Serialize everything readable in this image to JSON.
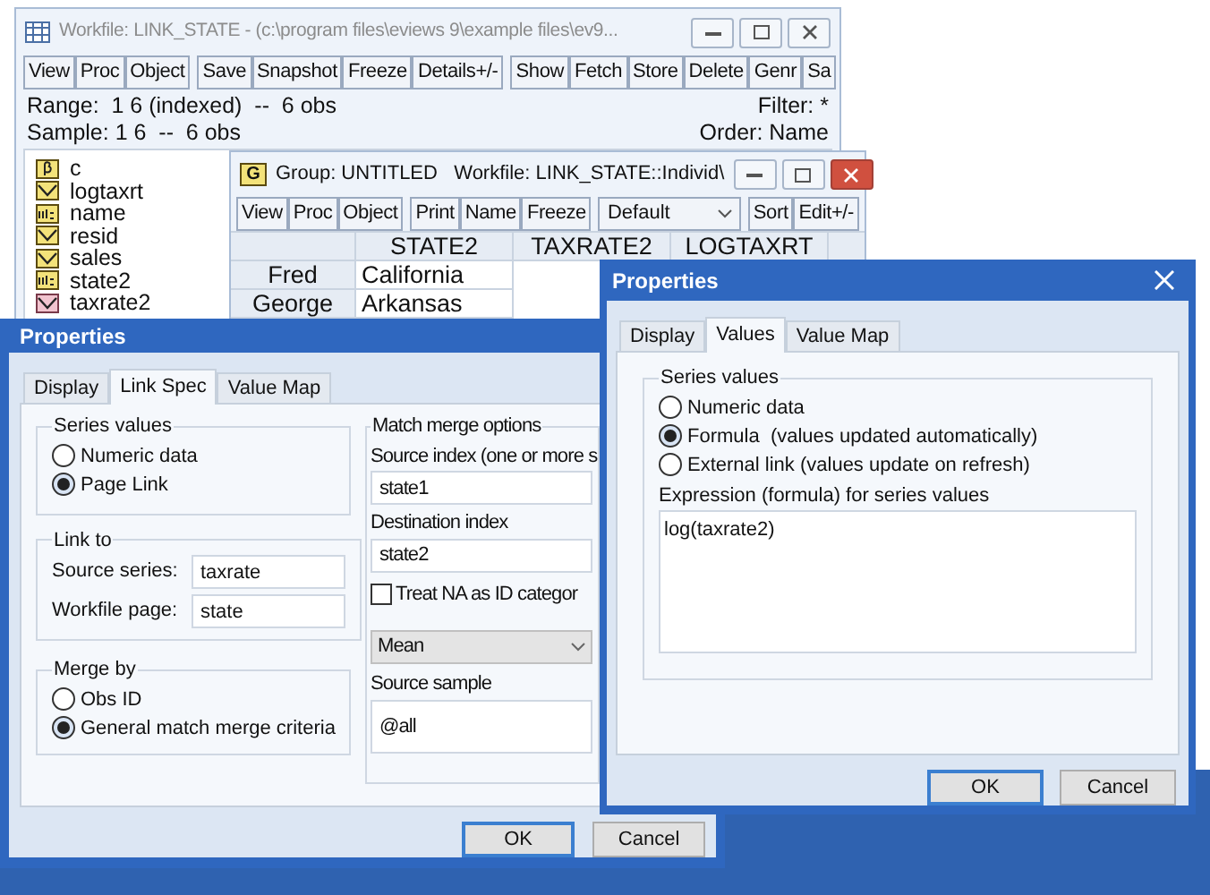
{
  "workfile_window": {
    "title": "Workfile: LINK_STATE - (c:\\program files\\eviews 9\\example files\\ev9...",
    "toolbar_groups": [
      [
        "View",
        "Proc",
        "Object"
      ],
      [
        "Save",
        "Snapshot",
        "Freeze",
        "Details+/-"
      ],
      [
        "Show",
        "Fetch",
        "Store",
        "Delete",
        "Genr",
        "Sa"
      ]
    ],
    "range": "Range:  1 6 (indexed)  --  6 obs",
    "filter": "Filter: *",
    "sample": "Sample: 1 6  --  6 obs",
    "order": "Order: Name",
    "objects": [
      {
        "name": "c",
        "kind": "coef"
      },
      {
        "name": "logtaxrt",
        "kind": "series"
      },
      {
        "name": "name",
        "kind": "alpha"
      },
      {
        "name": "resid",
        "kind": "series"
      },
      {
        "name": "sales",
        "kind": "series"
      },
      {
        "name": "state2",
        "kind": "alpha"
      },
      {
        "name": "taxrate2",
        "kind": "link"
      }
    ]
  },
  "group_window": {
    "icon_label": "G",
    "title": "Group: UNTITLED   Workfile: LINK_STATE::Individ\\",
    "toolbar_groups": [
      [
        "View",
        "Proc",
        "Object"
      ],
      [
        "Print",
        "Name",
        "Freeze"
      ]
    ],
    "view_select": "Default",
    "toolbar_right": [
      "Sort",
      "Edit+/-"
    ],
    "columns": [
      "STATE2",
      "TAXRATE2",
      "LOGTAXRT"
    ],
    "rows": [
      {
        "label": "Fred",
        "cells": [
          "California"
        ]
      },
      {
        "label": "George",
        "cells": [
          "Arkansas"
        ]
      }
    ]
  },
  "link_dialog": {
    "title": "Properties",
    "tabs": [
      {
        "label": "Display",
        "selected": false
      },
      {
        "label": "Link Spec",
        "selected": true
      },
      {
        "label": "Value Map",
        "selected": false
      }
    ],
    "series_values": {
      "label": "Series values",
      "options": [
        {
          "label": "Numeric data",
          "selected": false
        },
        {
          "label": "Page Link",
          "selected": true
        }
      ]
    },
    "link_to": {
      "label": "Link to",
      "fields": [
        {
          "label": "Source series:",
          "value": "taxrate"
        },
        {
          "label": "Workfile page:",
          "value": "state"
        }
      ]
    },
    "merge_by": {
      "label": "Merge by",
      "options": [
        {
          "label": "Obs ID",
          "selected": false
        },
        {
          "label": "General match merge criteria",
          "selected": true
        }
      ]
    },
    "match_merge": {
      "label": "Match merge options",
      "source_index": {
        "label": "Source index (one or more s",
        "value": "state1"
      },
      "destination_index": {
        "label": "Destination index",
        "value": "state2"
      },
      "treat_na": {
        "label": "Treat NA as ID categor",
        "checked": false
      },
      "method": "Mean",
      "source_sample": {
        "label": "Source sample",
        "value": "@all"
      }
    },
    "buttons": [
      {
        "label": "OK",
        "default": true
      },
      {
        "label": "Cancel",
        "default": false
      }
    ]
  },
  "values_dialog": {
    "title": "Properties",
    "tabs": [
      {
        "label": "Display",
        "selected": false
      },
      {
        "label": "Values",
        "selected": true
      },
      {
        "label": "Value Map",
        "selected": false
      }
    ],
    "series_values": {
      "label": "Series values",
      "options": [
        {
          "label": "Numeric data",
          "selected": false
        },
        {
          "label": "Formula  (values updated automatically)",
          "selected": true
        },
        {
          "label": "External link (values update on refresh)",
          "selected": false
        }
      ]
    },
    "expression": {
      "label": "Expression (formula) for series values",
      "value": "log(taxrate2)"
    },
    "buttons": [
      {
        "label": "OK",
        "default": true
      },
      {
        "label": "Cancel",
        "default": false
      }
    ]
  }
}
